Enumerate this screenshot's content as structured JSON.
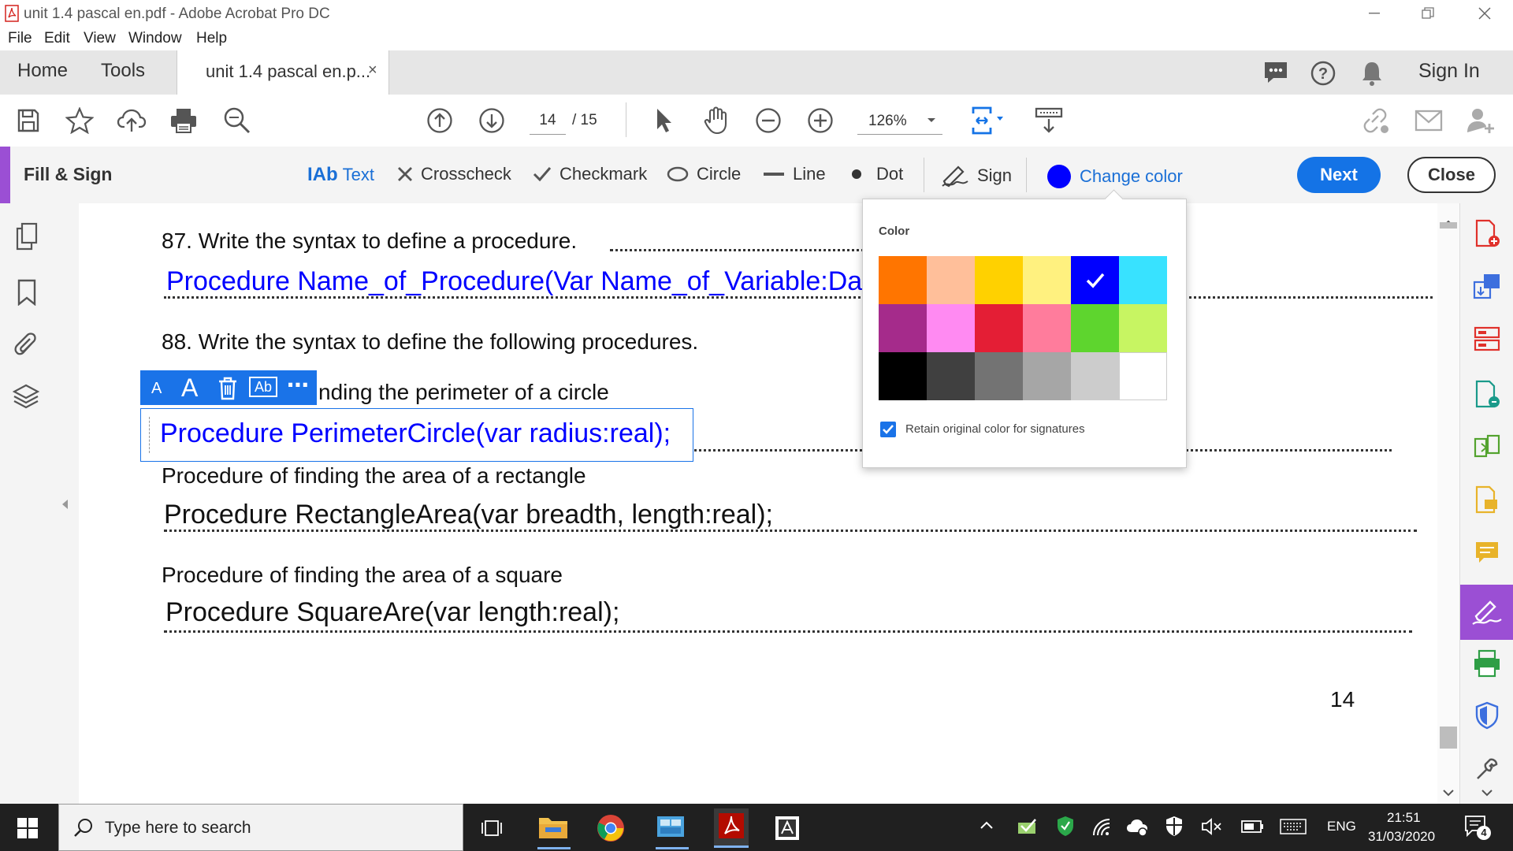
{
  "window": {
    "title": "unit 1.4 pascal en.pdf - Adobe Acrobat Pro DC"
  },
  "menu": [
    "File",
    "Edit",
    "View",
    "Window",
    "Help"
  ],
  "tabs": {
    "home": "Home",
    "tools": "Tools",
    "document": "unit 1.4 pascal en.p...",
    "close_glyph": "×",
    "sign_in": "Sign In"
  },
  "toolbar": {
    "page_current": "14",
    "page_total": "/ 15",
    "zoom": "126%"
  },
  "fill_sign": {
    "label": "Fill & Sign",
    "tools": {
      "text": "Text",
      "text_glyph": "IAb",
      "crosscheck": "Crosscheck",
      "checkmark": "Checkmark",
      "circle": "Circle",
      "line": "Line",
      "dot": "Dot",
      "sign": "Sign",
      "change_color": "Change color"
    },
    "next": "Next",
    "close": "Close",
    "current_color": "#0000ff"
  },
  "color_popup": {
    "title": "Color",
    "swatches": [
      [
        "#ff7500",
        "#ffbf9a",
        "#ffd100",
        "#fff17f",
        "#0000ff",
        "#38e2ff"
      ],
      [
        "#a52b8b",
        "#ff8af2",
        "#e41e35",
        "#ff7c9c",
        "#5ed52e",
        "#c7f562"
      ],
      [
        "#000000",
        "#404040",
        "#737373",
        "#a6a6a6",
        "#cccccc",
        "#ffffff"
      ]
    ],
    "selected": "#0000ff",
    "retain_label": "Retain original color for signatures",
    "retain_checked": true
  },
  "document": {
    "q87": "87. Write the syntax to define a procedure. ",
    "a87": "Procedure Name_of_Procedure(Var Name_of_Variable:Data_T",
    "q88": "88. Write the syntax to define the following procedures.",
    "perimeter_label": "nding the perimeter of a circle",
    "a_perimeter": "Procedure PerimeterCircle(var radius:real);",
    "area_rect_label": "Procedure of finding the area of a rectangle",
    "a_rect": "Procedure RectangleArea(var breadth, length:real);",
    "area_square_label": "Procedure of finding the area of a square",
    "a_square": "Procedure SquareAre(var length:real);",
    "page_number": "14"
  },
  "text_toolbar": {
    "small_a": "A",
    "large_a": "A",
    "more": "⋯",
    "ab": "Ab"
  },
  "taskbar": {
    "search_placeholder": "Type here to search",
    "language": "ENG",
    "time": "21:51",
    "date": "31/03/2020",
    "notifications": "4"
  }
}
